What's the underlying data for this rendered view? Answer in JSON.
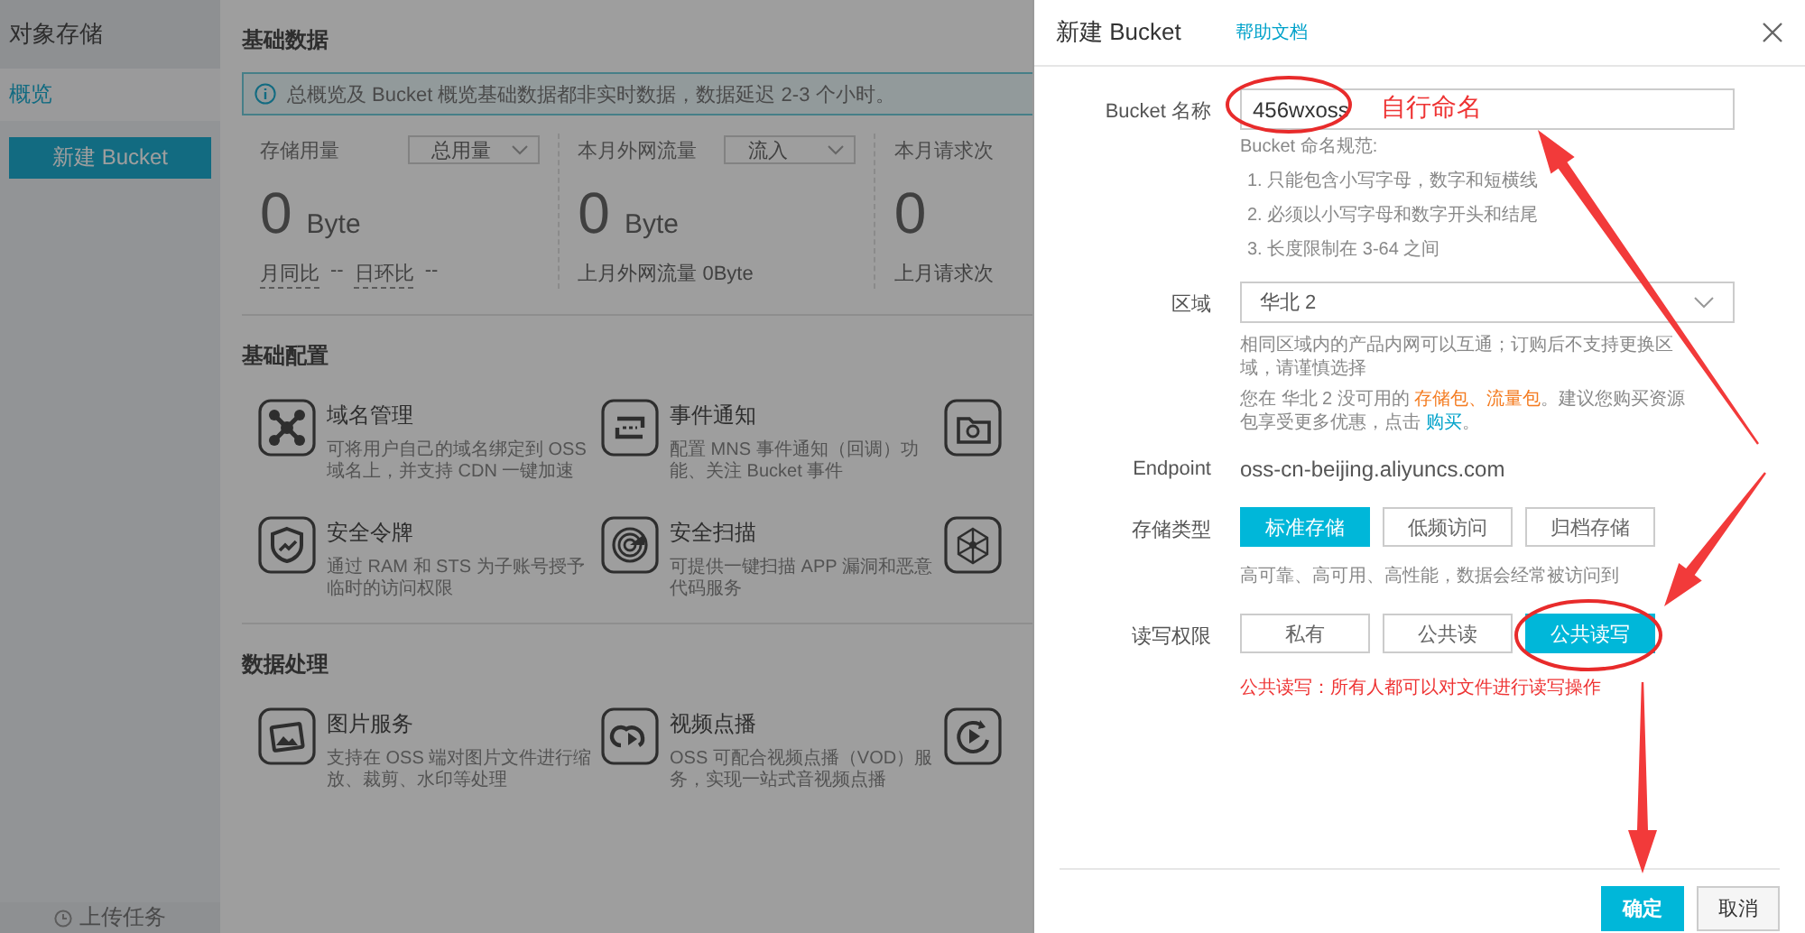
{
  "sidebar": {
    "title": "对象存储",
    "items": [
      {
        "label": "概览",
        "selected": true
      }
    ],
    "create_button": "新建 Bucket",
    "upload_tasks": "上传任务"
  },
  "main": {
    "section_data": "基础数据",
    "notice": "总概览及 Bucket 概览基础数据都非实时数据，数据延迟 2-3 个小时。",
    "stats": [
      {
        "label": "存储用量",
        "dropdown": "总用量",
        "value": "0",
        "unit": "Byte",
        "footer_items": [
          {
            "label": "月同比",
            "value": "--"
          },
          {
            "label": "日环比",
            "value": "--"
          }
        ]
      },
      {
        "label": "本月外网流量",
        "dropdown": "流入",
        "value": "0",
        "unit": "Byte",
        "footer": "上月外网流量  0Byte"
      },
      {
        "label": "本月请求次",
        "value": "0",
        "footer": "上月请求次"
      }
    ],
    "sections": [
      {
        "title": "基础配置",
        "rows": [
          [
            {
              "title": "域名管理",
              "lines": [
                "可将用户自己的域名绑定到 OSS",
                "域名上，并支持 CDN 一键加速"
              ]
            },
            {
              "title": "事件通知",
              "lines": [
                "配置 MNS 事件通知（回调）功",
                "能、关注 Bucket 事件"
              ]
            }
          ],
          [
            {
              "title": "安全令牌",
              "lines": [
                "通过 RAM 和 STS 为子账号授予",
                "临时的访问权限"
              ]
            },
            {
              "title": "安全扫描",
              "lines": [
                "可提供一键扫描 APP 漏洞和恶意",
                "代码服务"
              ]
            }
          ]
        ]
      },
      {
        "title": "数据处理",
        "rows": [
          [
            {
              "title": "图片服务",
              "lines": [
                "支持在 OSS 端对图片文件进行缩",
                "放、裁剪、水印等处理"
              ]
            },
            {
              "title": "视频点播",
              "lines": [
                "OSS 可配合视频点播（VOD）服",
                "务，实现一站式音视频点播"
              ]
            }
          ]
        ]
      }
    ]
  },
  "drawer": {
    "title": "新建 Bucket",
    "help_link": "帮助文档",
    "name_field": {
      "label": "Bucket 名称",
      "value": "456wxoss"
    },
    "naming_rules": {
      "title": "Bucket 命名规范:",
      "items": [
        "1. 只能包含小写字母，数字和短横线",
        "2. 必须以小写字母和数字开头和结尾",
        "3. 长度限制在 3-64 之间"
      ]
    },
    "region": {
      "label": "区域",
      "value": "华北 2",
      "note": "相同区域内的产品内网可以互通；订购后不支持更换区域，请谨慎选择",
      "offer": [
        {
          "text": "您在 华北 2 没可用的 "
        },
        {
          "text": "存储包、流量包",
          "kind": "offer_link"
        },
        {
          "text": "。建议您购买资源包享受更多优惠，点击 "
        },
        {
          "text": "购买",
          "kind": "link"
        },
        {
          "text": "。"
        }
      ]
    },
    "endpoint": {
      "label": "Endpoint",
      "value": "oss-cn-beijing.aliyuncs.com"
    },
    "storage_type": {
      "label": "存储类型",
      "options": [
        {
          "label": "标准存储",
          "selected": true
        },
        {
          "label": "低频访问",
          "selected": false
        },
        {
          "label": "归档存储",
          "selected": false
        }
      ],
      "hint": "高可靠、高可用、高性能，数据会经常被访问到"
    },
    "permission": {
      "label": "读写权限",
      "options": [
        {
          "label": "私有",
          "selected": false
        },
        {
          "label": "公共读",
          "selected": false
        },
        {
          "label": "公共读写",
          "selected": true
        }
      ],
      "warning": "公共读写：所有人都可以对文件进行读写操作"
    },
    "buttons": [
      {
        "label": "确定",
        "kind": "primary"
      },
      {
        "label": "取消",
        "kind": "secondary"
      }
    ]
  },
  "annotation": {
    "label": "自行命名"
  }
}
